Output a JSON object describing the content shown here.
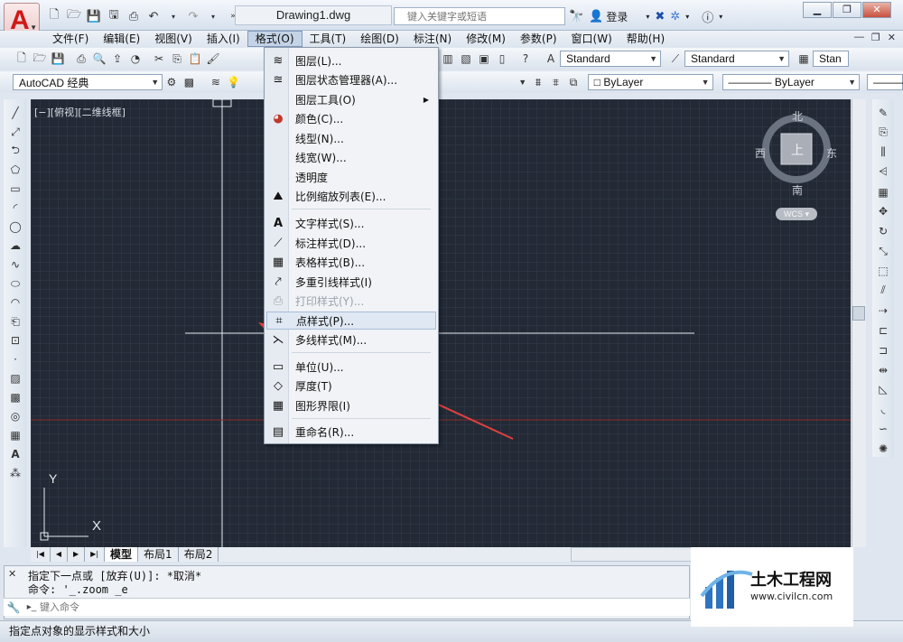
{
  "app": {
    "logo_letter": "A",
    "document_title": "Drawing1.dwg"
  },
  "quick_access": {
    "icons": [
      "new-icon",
      "open-icon",
      "save-icon",
      "save-as-icon",
      "print-icon",
      "undo-icon",
      "redo-icon"
    ]
  },
  "search": {
    "placeholder": "键入关键字或短语"
  },
  "title_tools": {
    "login_label": "登录"
  },
  "menubar": {
    "items": [
      "文件(F)",
      "编辑(E)",
      "视图(V)",
      "插入(I)",
      "格式(O)",
      "工具(T)",
      "绘图(D)",
      "标注(N)",
      "修改(M)",
      "参数(P)",
      "窗口(W)",
      "帮助(H)"
    ],
    "active_index": 4
  },
  "toolbar1": {
    "text_style": "Standard",
    "dim_style": "Standard",
    "table_style": "Stan"
  },
  "toolbar2": {
    "workspace": "AutoCAD 经典",
    "color": "ByLayer",
    "linetype": "ByLayer"
  },
  "canvas": {
    "viewport_label": "[−][俯视][二维线框]",
    "background": "#232a35",
    "axis_x": "X",
    "axis_y": "Y"
  },
  "viewcube": {
    "north": "北",
    "south": "南",
    "east": "东",
    "west": "西",
    "top": "上",
    "wcs": "WCS"
  },
  "format_menu": {
    "items": [
      {
        "label": "图层(L)...",
        "icon": "layer-icon"
      },
      {
        "label": "图层状态管理器(A)...",
        "icon": "layer-state-icon"
      },
      {
        "label": "图层工具(O)",
        "icon": "",
        "has_sub": true
      },
      {
        "label": "颜色(C)...",
        "icon": "color-wheel-icon"
      },
      {
        "label": "线型(N)...",
        "icon": ""
      },
      {
        "label": "线宽(W)...",
        "icon": ""
      },
      {
        "label": "透明度",
        "icon": ""
      },
      {
        "label": "比例缩放列表(E)...",
        "icon": "scale-list-icon"
      },
      {
        "label": "文字样式(S)...",
        "icon": "text-style-icon"
      },
      {
        "label": "标注样式(D)...",
        "icon": "dim-style-icon"
      },
      {
        "label": "表格样式(B)...",
        "icon": "table-style-icon"
      },
      {
        "label": "多重引线样式(I)",
        "icon": "mleader-style-icon"
      },
      {
        "label": "打印样式(Y)...",
        "icon": "plot-style-icon",
        "disabled": true
      },
      {
        "label": "点样式(P)...",
        "icon": "point-style-icon",
        "hover": true
      },
      {
        "label": "多线样式(M)...",
        "icon": "mline-style-icon"
      },
      {
        "label": "单位(U)...",
        "icon": "units-icon"
      },
      {
        "label": "厚度(T)",
        "icon": "thickness-icon"
      },
      {
        "label": "图形界限(I)",
        "icon": "limits-icon"
      },
      {
        "label": "重命名(R)...",
        "icon": "rename-icon"
      }
    ]
  },
  "tabs": [
    "模型",
    "布局1",
    "布局2"
  ],
  "command": {
    "history": [
      "指定下一点或 [放弃(U)]: *取消*",
      "命令: '_.zoom _e"
    ],
    "input_placeholder": "键入命令"
  },
  "status_bar": {
    "text": "指定点对象的显示样式和大小"
  },
  "watermark": {
    "brand": "土木工程网",
    "url": "www.civilcn.com"
  }
}
